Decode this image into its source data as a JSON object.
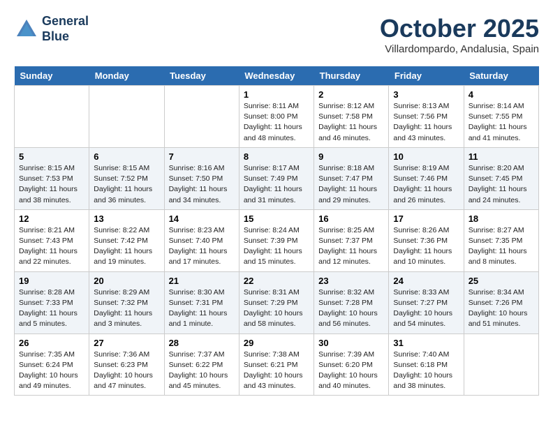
{
  "header": {
    "logo_line1": "General",
    "logo_line2": "Blue",
    "month": "October 2025",
    "location": "Villardompardo, Andalusia, Spain"
  },
  "weekdays": [
    "Sunday",
    "Monday",
    "Tuesday",
    "Wednesday",
    "Thursday",
    "Friday",
    "Saturday"
  ],
  "weeks": [
    [
      {
        "day": "",
        "content": ""
      },
      {
        "day": "",
        "content": ""
      },
      {
        "day": "",
        "content": ""
      },
      {
        "day": "1",
        "content": "Sunrise: 8:11 AM\nSunset: 8:00 PM\nDaylight: 11 hours\nand 48 minutes."
      },
      {
        "day": "2",
        "content": "Sunrise: 8:12 AM\nSunset: 7:58 PM\nDaylight: 11 hours\nand 46 minutes."
      },
      {
        "day": "3",
        "content": "Sunrise: 8:13 AM\nSunset: 7:56 PM\nDaylight: 11 hours\nand 43 minutes."
      },
      {
        "day": "4",
        "content": "Sunrise: 8:14 AM\nSunset: 7:55 PM\nDaylight: 11 hours\nand 41 minutes."
      }
    ],
    [
      {
        "day": "5",
        "content": "Sunrise: 8:15 AM\nSunset: 7:53 PM\nDaylight: 11 hours\nand 38 minutes."
      },
      {
        "day": "6",
        "content": "Sunrise: 8:15 AM\nSunset: 7:52 PM\nDaylight: 11 hours\nand 36 minutes."
      },
      {
        "day": "7",
        "content": "Sunrise: 8:16 AM\nSunset: 7:50 PM\nDaylight: 11 hours\nand 34 minutes."
      },
      {
        "day": "8",
        "content": "Sunrise: 8:17 AM\nSunset: 7:49 PM\nDaylight: 11 hours\nand 31 minutes."
      },
      {
        "day": "9",
        "content": "Sunrise: 8:18 AM\nSunset: 7:47 PM\nDaylight: 11 hours\nand 29 minutes."
      },
      {
        "day": "10",
        "content": "Sunrise: 8:19 AM\nSunset: 7:46 PM\nDaylight: 11 hours\nand 26 minutes."
      },
      {
        "day": "11",
        "content": "Sunrise: 8:20 AM\nSunset: 7:45 PM\nDaylight: 11 hours\nand 24 minutes."
      }
    ],
    [
      {
        "day": "12",
        "content": "Sunrise: 8:21 AM\nSunset: 7:43 PM\nDaylight: 11 hours\nand 22 minutes."
      },
      {
        "day": "13",
        "content": "Sunrise: 8:22 AM\nSunset: 7:42 PM\nDaylight: 11 hours\nand 19 minutes."
      },
      {
        "day": "14",
        "content": "Sunrise: 8:23 AM\nSunset: 7:40 PM\nDaylight: 11 hours\nand 17 minutes."
      },
      {
        "day": "15",
        "content": "Sunrise: 8:24 AM\nSunset: 7:39 PM\nDaylight: 11 hours\nand 15 minutes."
      },
      {
        "day": "16",
        "content": "Sunrise: 8:25 AM\nSunset: 7:37 PM\nDaylight: 11 hours\nand 12 minutes."
      },
      {
        "day": "17",
        "content": "Sunrise: 8:26 AM\nSunset: 7:36 PM\nDaylight: 11 hours\nand 10 minutes."
      },
      {
        "day": "18",
        "content": "Sunrise: 8:27 AM\nSunset: 7:35 PM\nDaylight: 11 hours\nand 8 minutes."
      }
    ],
    [
      {
        "day": "19",
        "content": "Sunrise: 8:28 AM\nSunset: 7:33 PM\nDaylight: 11 hours\nand 5 minutes."
      },
      {
        "day": "20",
        "content": "Sunrise: 8:29 AM\nSunset: 7:32 PM\nDaylight: 11 hours\nand 3 minutes."
      },
      {
        "day": "21",
        "content": "Sunrise: 8:30 AM\nSunset: 7:31 PM\nDaylight: 11 hours\nand 1 minute."
      },
      {
        "day": "22",
        "content": "Sunrise: 8:31 AM\nSunset: 7:29 PM\nDaylight: 10 hours\nand 58 minutes."
      },
      {
        "day": "23",
        "content": "Sunrise: 8:32 AM\nSunset: 7:28 PM\nDaylight: 10 hours\nand 56 minutes."
      },
      {
        "day": "24",
        "content": "Sunrise: 8:33 AM\nSunset: 7:27 PM\nDaylight: 10 hours\nand 54 minutes."
      },
      {
        "day": "25",
        "content": "Sunrise: 8:34 AM\nSunset: 7:26 PM\nDaylight: 10 hours\nand 51 minutes."
      }
    ],
    [
      {
        "day": "26",
        "content": "Sunrise: 7:35 AM\nSunset: 6:24 PM\nDaylight: 10 hours\nand 49 minutes."
      },
      {
        "day": "27",
        "content": "Sunrise: 7:36 AM\nSunset: 6:23 PM\nDaylight: 10 hours\nand 47 minutes."
      },
      {
        "day": "28",
        "content": "Sunrise: 7:37 AM\nSunset: 6:22 PM\nDaylight: 10 hours\nand 45 minutes."
      },
      {
        "day": "29",
        "content": "Sunrise: 7:38 AM\nSunset: 6:21 PM\nDaylight: 10 hours\nand 43 minutes."
      },
      {
        "day": "30",
        "content": "Sunrise: 7:39 AM\nSunset: 6:20 PM\nDaylight: 10 hours\nand 40 minutes."
      },
      {
        "day": "31",
        "content": "Sunrise: 7:40 AM\nSunset: 6:18 PM\nDaylight: 10 hours\nand 38 minutes."
      },
      {
        "day": "",
        "content": ""
      }
    ]
  ]
}
